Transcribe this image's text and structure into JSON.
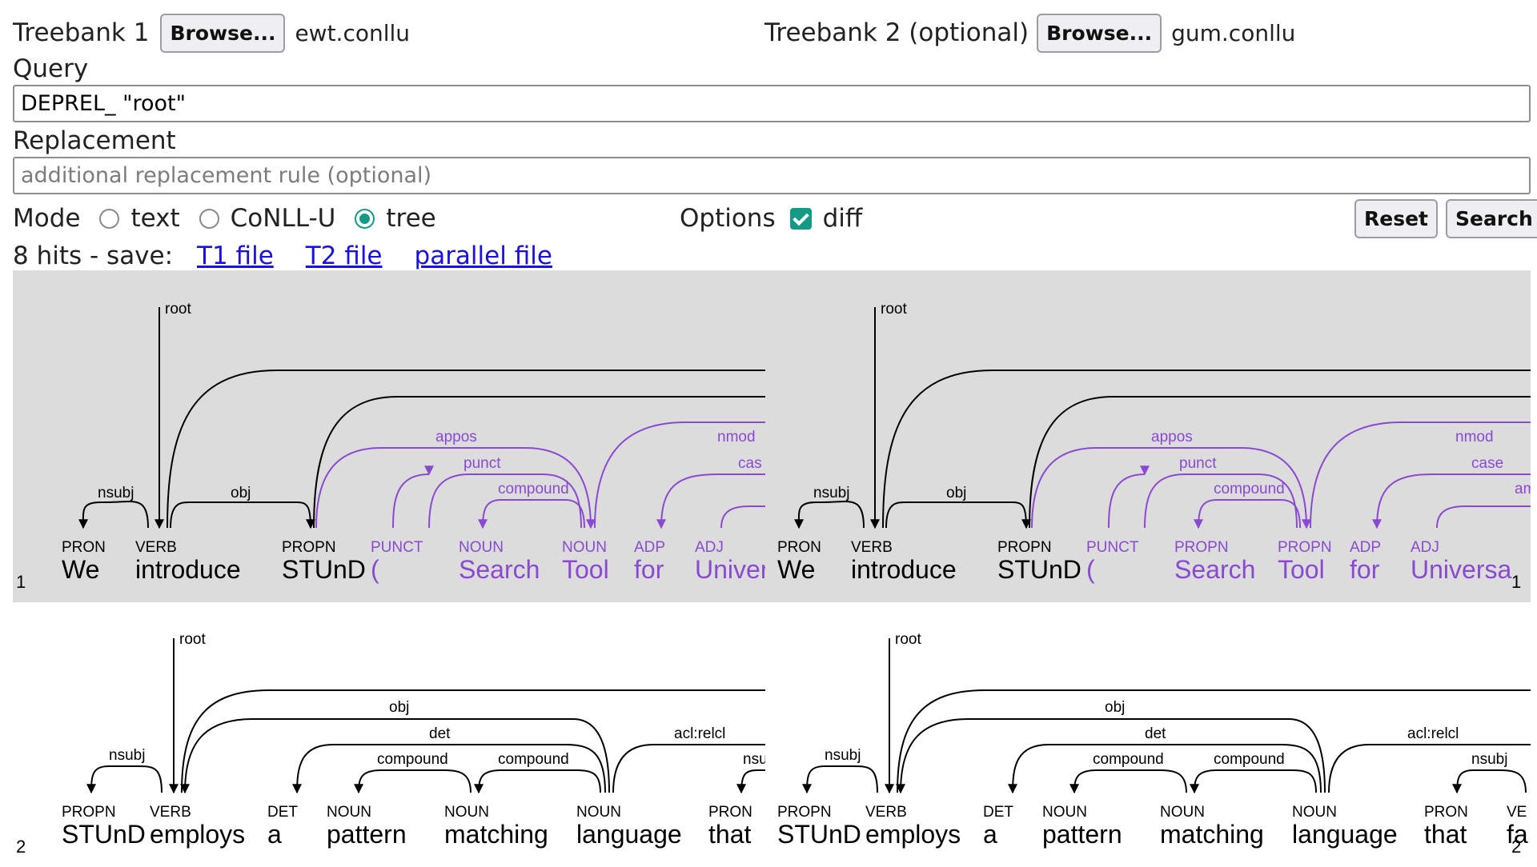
{
  "treebank1": {
    "label": "Treebank 1",
    "browse": "Browse...",
    "file": "ewt.conllu"
  },
  "treebank2": {
    "label": "Treebank 2 (optional)",
    "browse": "Browse...",
    "file": "gum.conllu"
  },
  "query": {
    "label": "Query",
    "value": "DEPREL_ \"root\""
  },
  "replacement": {
    "label": "Replacement",
    "placeholder": "additional replacement rule (optional)",
    "value": ""
  },
  "mode": {
    "label": "Mode",
    "options": [
      "text",
      "CoNLL-U",
      "tree"
    ],
    "selected": "tree"
  },
  "options": {
    "label": "Options",
    "diff_label": "diff",
    "diff_checked": true
  },
  "buttons": {
    "reset": "Reset",
    "search": "Search"
  },
  "results": {
    "summary": "8 hits - save:",
    "links": [
      "T1 file",
      "T2 file",
      "parallel file"
    ]
  },
  "colors": {
    "accent": "#159a85",
    "diff": "#8a4ad0",
    "link": "#1a10e6",
    "panel_bg": "#dcdcdc"
  },
  "hits": [
    {
      "number": "1",
      "left": {
        "tokens": [
          {
            "pos": "PRON",
            "word": "We"
          },
          {
            "pos": "VERB",
            "word": "introduce"
          },
          {
            "pos": "PROPN",
            "word": "STUnD"
          },
          {
            "pos": "PUNCT",
            "word": "(",
            "diff": true
          },
          {
            "pos": "NOUN",
            "word": "Search",
            "diff": true
          },
          {
            "pos": "NOUN",
            "word": "Tool",
            "diff": true
          },
          {
            "pos": "ADP",
            "word": "for",
            "diff": true
          },
          {
            "pos": "ADJ",
            "word": "Univer",
            "diff": true
          }
        ],
        "root_label": "root",
        "arc_labels": [
          "nsubj",
          "obj",
          "",
          "",
          "appos",
          "punct",
          "compound",
          "nmod",
          "cas"
        ]
      },
      "right": {
        "tokens": [
          {
            "pos": "PRON",
            "word": "We"
          },
          {
            "pos": "VERB",
            "word": "introduce"
          },
          {
            "pos": "PROPN",
            "word": "STUnD"
          },
          {
            "pos": "PUNCT",
            "word": "(",
            "diff": true
          },
          {
            "pos": "PROPN",
            "word": "Search",
            "diff": true
          },
          {
            "pos": "PROPN",
            "word": "Tool",
            "diff": true
          },
          {
            "pos": "ADP",
            "word": "for",
            "diff": true
          },
          {
            "pos": "ADJ",
            "word": "Universa",
            "diff": true
          }
        ],
        "root_label": "root",
        "arc_labels": [
          "nsubj",
          "obj",
          "",
          "",
          "appos",
          "punct",
          "compound",
          "nmod",
          "case",
          "am"
        ]
      }
    },
    {
      "number": "2",
      "left": {
        "tokens": [
          {
            "pos": "PROPN",
            "word": "STUnD"
          },
          {
            "pos": "VERB",
            "word": "employs"
          },
          {
            "pos": "DET",
            "word": "a"
          },
          {
            "pos": "NOUN",
            "word": "pattern"
          },
          {
            "pos": "NOUN",
            "word": "matching"
          },
          {
            "pos": "NOUN",
            "word": "language"
          },
          {
            "pos": "PRON",
            "word": "that"
          }
        ],
        "root_label": "root",
        "arc_labels": [
          "nsubj",
          "",
          "obj",
          "det",
          "compound",
          "compound",
          "acl:relcl",
          "nsu"
        ]
      },
      "right": {
        "tokens": [
          {
            "pos": "PROPN",
            "word": "STUnD"
          },
          {
            "pos": "VERB",
            "word": "employs"
          },
          {
            "pos": "DET",
            "word": "a"
          },
          {
            "pos": "NOUN",
            "word": "pattern"
          },
          {
            "pos": "NOUN",
            "word": "matching"
          },
          {
            "pos": "NOUN",
            "word": "language"
          },
          {
            "pos": "PRON",
            "word": "that"
          },
          {
            "pos": "VE",
            "word": "fa"
          }
        ],
        "root_label": "root",
        "arc_labels": [
          "nsubj",
          "",
          "obj",
          "det",
          "compound",
          "compound",
          "acl:relcl",
          "nsubj"
        ]
      }
    }
  ]
}
